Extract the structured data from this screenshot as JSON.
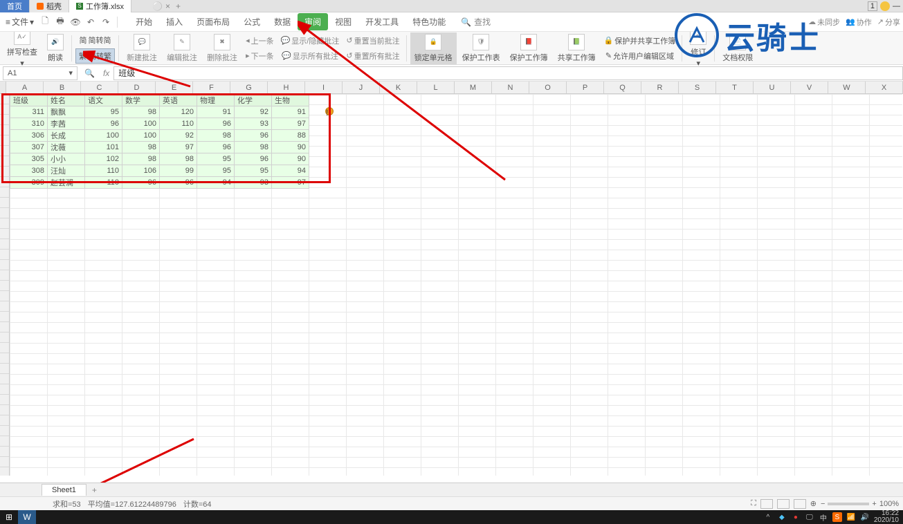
{
  "tabs": {
    "home": "首页",
    "daoke": "稻壳",
    "file": "工作簿.xlsx",
    "add": "+"
  },
  "topright": {
    "box": "1"
  },
  "menu": {
    "file": "文件",
    "qat": [
      "🗋",
      "🖶",
      "🗎",
      "↶",
      "↷"
    ],
    "tabs": [
      "开始",
      "插入",
      "页面布局",
      "公式",
      "数据",
      "审阅",
      "视图",
      "开发工具",
      "特色功能"
    ],
    "search": "查找",
    "right": {
      "sync": "未同步",
      "coop": "协作",
      "share": "分享"
    }
  },
  "ribbon": {
    "spellcheck": "拼写检查",
    "read": "朗读",
    "simp": "简转简",
    "trad": "繁 简转繁",
    "newcomment": "新建批注",
    "editcomment": "编辑批注",
    "delcomment": "删除批注",
    "prev": "上一条",
    "next": "下一条",
    "showhide": "显示/隐藏批注",
    "showall": "显示所有批注",
    "resetcur": "重置当前批注",
    "resetall": "重置所有批注",
    "lockcell": "锁定单元格",
    "protectsheet": "保护工作表",
    "protectbook": "保护工作簿",
    "sharebook": "共享工作簿",
    "protectshare": "保护并共享工作簿",
    "alloweditrange": "允许用户编辑区域",
    "revise": "修订",
    "docperm": "文档权限"
  },
  "logo": "云骑士",
  "formula": {
    "cell": "A1",
    "fx": "fx",
    "value": "班级"
  },
  "columns": [
    "A",
    "B",
    "C",
    "D",
    "E",
    "F",
    "G",
    "H",
    "I",
    "J",
    "K",
    "L",
    "M",
    "N",
    "O",
    "P",
    "Q",
    "R",
    "S",
    "T",
    "U",
    "V",
    "W",
    "X"
  ],
  "chart_data": {
    "type": "table",
    "headers": [
      "班级",
      "姓名",
      "语文",
      "数学",
      "英语",
      "物理",
      "化学",
      "生物"
    ],
    "rows": [
      [
        "311",
        "飘飘",
        "95",
        "98",
        "120",
        "91",
        "92",
        "91"
      ],
      [
        "310",
        "李茜",
        "96",
        "100",
        "110",
        "96",
        "93",
        "97"
      ],
      [
        "306",
        "长成",
        "100",
        "100",
        "92",
        "98",
        "96",
        "88"
      ],
      [
        "307",
        "沈薇",
        "101",
        "98",
        "97",
        "96",
        "98",
        "90"
      ],
      [
        "305",
        "小小",
        "102",
        "98",
        "98",
        "95",
        "96",
        "90"
      ],
      [
        "308",
        "汪灿",
        "110",
        "106",
        "99",
        "95",
        "95",
        "94"
      ],
      [
        "309",
        "赵芸澜",
        "110",
        "96",
        "96",
        "94",
        "93",
        "97"
      ]
    ]
  },
  "sheet": {
    "name": "Sheet1"
  },
  "status": {
    "sum_label": "求和=",
    "sum": "53",
    "avg": "平均值=127.61224489796",
    "count": "计数=64",
    "zoom": "100%"
  },
  "tray": {
    "time": "16:22",
    "date": "2020/10",
    "ime": "中"
  }
}
